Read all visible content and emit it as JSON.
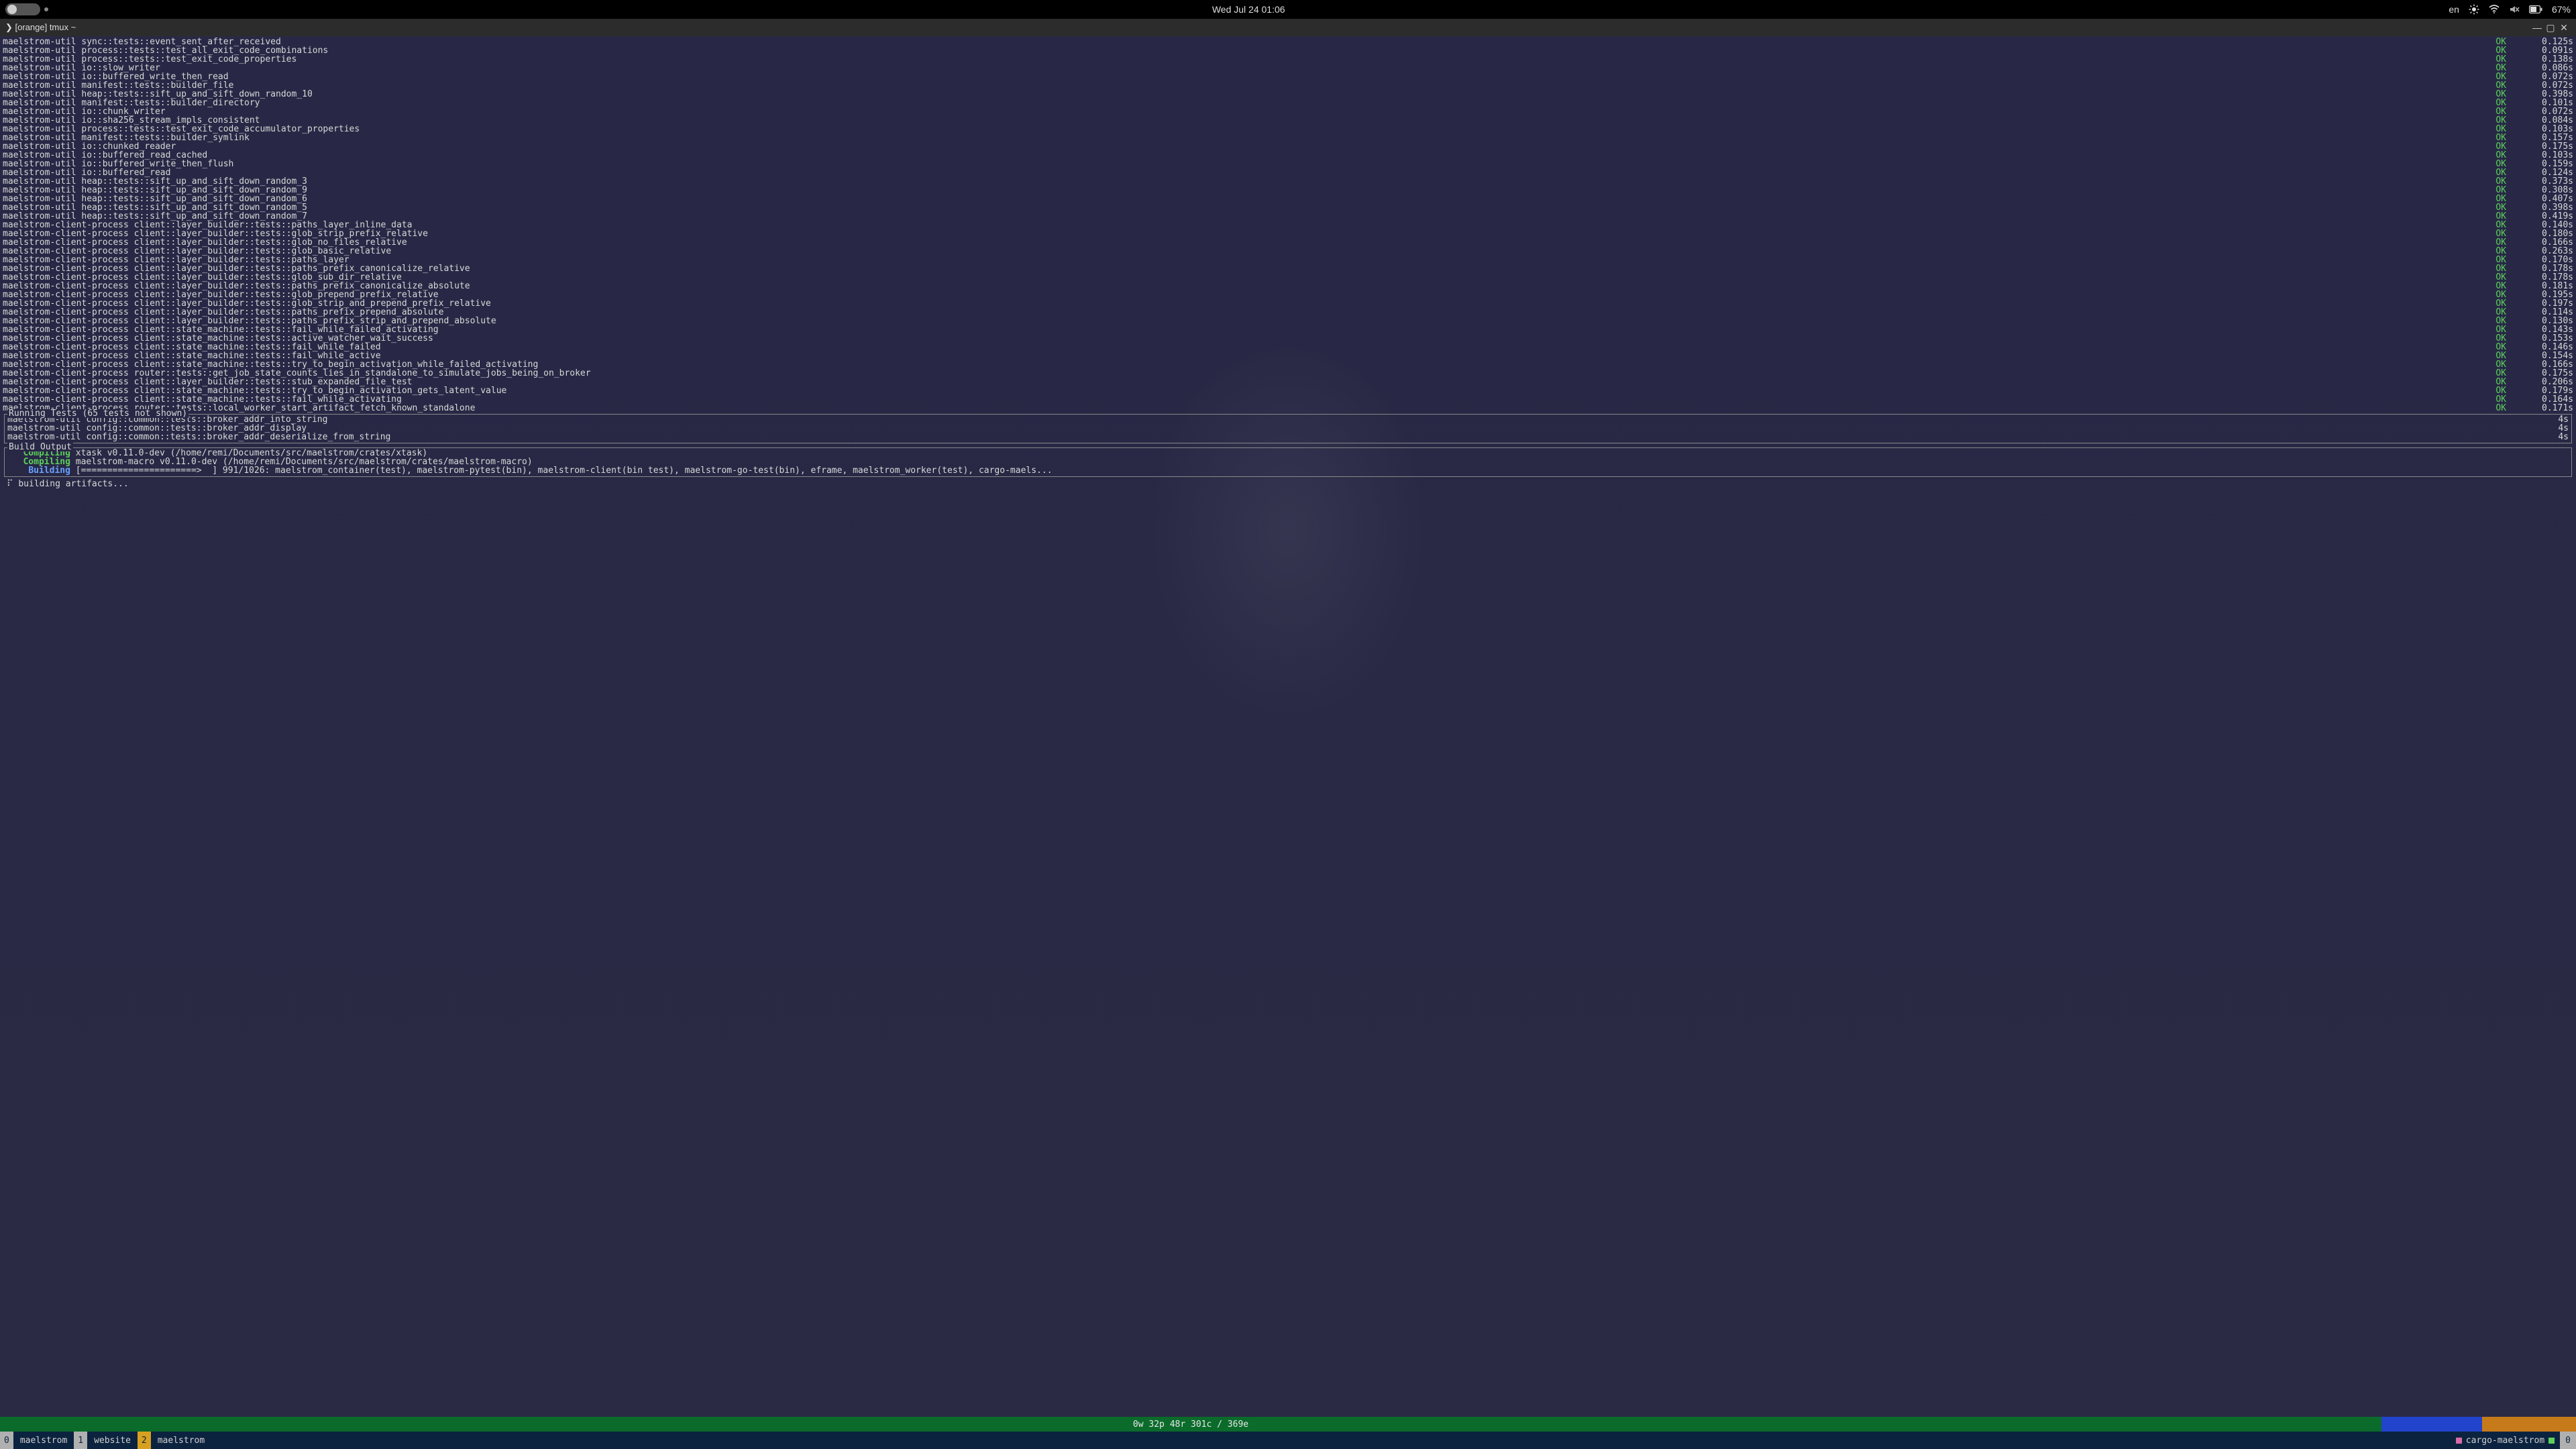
{
  "topbar": {
    "datetime": "Wed Jul 24  01:06",
    "lang": "en",
    "battery": "67%"
  },
  "titlebar": {
    "prompt": "❯ [orange] tmux ~"
  },
  "tests": [
    {
      "name": "maelstrom-util sync::tests::event_sent_after_received",
      "status": "OK",
      "dur": "0.125s"
    },
    {
      "name": "maelstrom-util process::tests::test_all_exit_code_combinations",
      "status": "OK",
      "dur": "0.091s"
    },
    {
      "name": "maelstrom-util process::tests::test_exit_code_properties",
      "status": "OK",
      "dur": "0.138s"
    },
    {
      "name": "maelstrom-util io::slow_writer",
      "status": "OK",
      "dur": "0.086s"
    },
    {
      "name": "maelstrom-util io::buffered_write_then_read",
      "status": "OK",
      "dur": "0.072s"
    },
    {
      "name": "maelstrom-util manifest::tests::builder_file",
      "status": "OK",
      "dur": "0.072s"
    },
    {
      "name": "maelstrom-util heap::tests::sift_up_and_sift_down_random_10",
      "status": "OK",
      "dur": "0.398s"
    },
    {
      "name": "maelstrom-util manifest::tests::builder_directory",
      "status": "OK",
      "dur": "0.101s"
    },
    {
      "name": "maelstrom-util io::chunk_writer",
      "status": "OK",
      "dur": "0.072s"
    },
    {
      "name": "maelstrom-util io::sha256_stream_impls_consistent",
      "status": "OK",
      "dur": "0.084s"
    },
    {
      "name": "maelstrom-util process::tests::test_exit_code_accumulator_properties",
      "status": "OK",
      "dur": "0.103s"
    },
    {
      "name": "maelstrom-util manifest::tests::builder_symlink",
      "status": "OK",
      "dur": "0.157s"
    },
    {
      "name": "maelstrom-util io::chunked_reader",
      "status": "OK",
      "dur": "0.175s"
    },
    {
      "name": "maelstrom-util io::buffered_read_cached",
      "status": "OK",
      "dur": "0.103s"
    },
    {
      "name": "maelstrom-util io::buffered_write_then_flush",
      "status": "OK",
      "dur": "0.159s"
    },
    {
      "name": "maelstrom-util io::buffered_read",
      "status": "OK",
      "dur": "0.124s"
    },
    {
      "name": "maelstrom-util heap::tests::sift_up_and_sift_down_random_3",
      "status": "OK",
      "dur": "0.373s"
    },
    {
      "name": "maelstrom-util heap::tests::sift_up_and_sift_down_random_9",
      "status": "OK",
      "dur": "0.308s"
    },
    {
      "name": "maelstrom-util heap::tests::sift_up_and_sift_down_random_6",
      "status": "OK",
      "dur": "0.407s"
    },
    {
      "name": "maelstrom-util heap::tests::sift_up_and_sift_down_random_5",
      "status": "OK",
      "dur": "0.398s"
    },
    {
      "name": "maelstrom-util heap::tests::sift_up_and_sift_down_random_7",
      "status": "OK",
      "dur": "0.419s"
    },
    {
      "name": "maelstrom-client-process client::layer_builder::tests::paths_layer_inline_data",
      "status": "OK",
      "dur": "0.140s"
    },
    {
      "name": "maelstrom-client-process client::layer_builder::tests::glob_strip_prefix_relative",
      "status": "OK",
      "dur": "0.180s"
    },
    {
      "name": "maelstrom-client-process client::layer_builder::tests::glob_no_files_relative",
      "status": "OK",
      "dur": "0.166s"
    },
    {
      "name": "maelstrom-client-process client::layer_builder::tests::glob_basic_relative",
      "status": "OK",
      "dur": "0.263s"
    },
    {
      "name": "maelstrom-client-process client::layer_builder::tests::paths_layer",
      "status": "OK",
      "dur": "0.170s"
    },
    {
      "name": "maelstrom-client-process client::layer_builder::tests::paths_prefix_canonicalize_relative",
      "status": "OK",
      "dur": "0.178s"
    },
    {
      "name": "maelstrom-client-process client::layer_builder::tests::glob_sub_dir_relative",
      "status": "OK",
      "dur": "0.178s"
    },
    {
      "name": "maelstrom-client-process client::layer_builder::tests::paths_prefix_canonicalize_absolute",
      "status": "OK",
      "dur": "0.181s"
    },
    {
      "name": "maelstrom-client-process client::layer_builder::tests::glob_prepend_prefix_relative",
      "status": "OK",
      "dur": "0.195s"
    },
    {
      "name": "maelstrom-client-process client::layer_builder::tests::glob_strip_and_prepend_prefix_relative",
      "status": "OK",
      "dur": "0.197s"
    },
    {
      "name": "maelstrom-client-process client::layer_builder::tests::paths_prefix_prepend_absolute",
      "status": "OK",
      "dur": "0.114s"
    },
    {
      "name": "maelstrom-client-process client::layer_builder::tests::paths_prefix_strip_and_prepend_absolute",
      "status": "OK",
      "dur": "0.130s"
    },
    {
      "name": "maelstrom-client-process client::state_machine::tests::fail_while_failed_activating",
      "status": "OK",
      "dur": "0.143s"
    },
    {
      "name": "maelstrom-client-process client::state_machine::tests::active_watcher_wait_success",
      "status": "OK",
      "dur": "0.153s"
    },
    {
      "name": "maelstrom-client-process client::state_machine::tests::fail_while_failed",
      "status": "OK",
      "dur": "0.146s"
    },
    {
      "name": "maelstrom-client-process client::state_machine::tests::fail_while_active",
      "status": "OK",
      "dur": "0.154s"
    },
    {
      "name": "maelstrom-client-process client::state_machine::tests::try_to_begin_activation_while_failed_activating",
      "status": "OK",
      "dur": "0.166s"
    },
    {
      "name": "maelstrom-client-process router::tests::get_job_state_counts_lies_in_standalone_to_simulate_jobs_being_on_broker",
      "status": "OK",
      "dur": "0.175s"
    },
    {
      "name": "maelstrom-client-process client::layer_builder::tests::stub_expanded_file_test",
      "status": "OK",
      "dur": "0.206s"
    },
    {
      "name": "maelstrom-client-process client::state_machine::tests::try_to_begin_activation_gets_latent_value",
      "status": "OK",
      "dur": "0.179s"
    },
    {
      "name": "maelstrom-client-process client::state_machine::tests::fail_while_activating",
      "status": "OK",
      "dur": "0.164s"
    },
    {
      "name": "maelstrom-client-process router::tests::local_worker_start_artifact_fetch_known_standalone",
      "status": "OK",
      "dur": "0.171s"
    }
  ],
  "running": {
    "title": "Running Tests (65 tests not shown)",
    "lines": [
      {
        "name": "maelstrom-util config::common::tests::broker_addr_into_string",
        "t": "4s"
      },
      {
        "name": "maelstrom-util config::common::tests::broker_addr_display",
        "t": "4s"
      },
      {
        "name": "maelstrom-util config::common::tests::broker_addr_deserialize_from_string",
        "t": "4s"
      }
    ]
  },
  "build": {
    "title": "Build Output",
    "lines": [
      {
        "verb": "Compiling",
        "rest": " xtask v0.11.0-dev (/home/remi/Documents/src/maelstrom/crates/xtask)"
      },
      {
        "verb": "Compiling",
        "rest": " maelstrom-macro v0.11.0-dev (/home/remi/Documents/src/maelstrom/crates/maelstrom-macro)"
      }
    ],
    "building_verb": "Building",
    "building_rest": " [======================>  ] 991/1026: maelstrom_container(test), maelstrom-pytest(bin), maelstrom-client(bin test), maelstrom-go-test(bin), eframe, maelstrom_worker(test), cargo-maels..."
  },
  "status_line": "⠏ building artifacts...",
  "greenbar": "0w 32p 48r 301c / 369e",
  "tmux": {
    "tabs": [
      {
        "num": "0",
        "label": "maelstrom",
        "active": false
      },
      {
        "num": "1",
        "label": "website",
        "active": false
      },
      {
        "num": "2",
        "label": "maelstrom",
        "active": true
      }
    ],
    "session": "cargo-maelstrom",
    "endnum": "0"
  }
}
